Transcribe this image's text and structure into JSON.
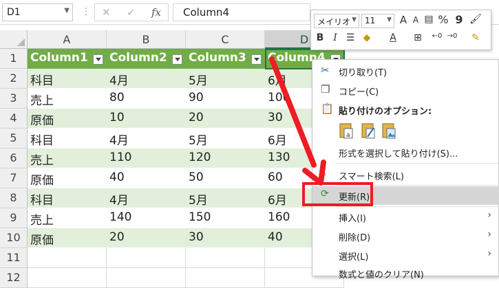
{
  "formula_bar": {
    "name_box": "D1",
    "sep": "⋮",
    "cancel": "✕",
    "enter": "✓",
    "fx": "fx",
    "value": "Column4"
  },
  "grid": {
    "columns": [
      "A",
      "B",
      "C",
      "D"
    ],
    "row_numbers": [
      "1",
      "2",
      "3",
      "4",
      "5",
      "6",
      "7",
      "8",
      "9",
      "10",
      "11",
      "12"
    ],
    "header": [
      "Column1",
      "Column2",
      "Column3",
      "Column4"
    ],
    "rows": [
      [
        "科目",
        "4月",
        "5月",
        "6月"
      ],
      [
        "売上",
        "80",
        "90",
        "100"
      ],
      [
        "原価",
        "10",
        "20",
        "30"
      ],
      [
        "科目",
        "4月",
        "5月",
        "6月"
      ],
      [
        "売上",
        "110",
        "120",
        "130"
      ],
      [
        "原価",
        "40",
        "50",
        "60"
      ],
      [
        "科目",
        "4月",
        "5月",
        "6月"
      ],
      [
        "売上",
        "140",
        "150",
        "160"
      ],
      [
        "原価",
        "20",
        "30",
        "40"
      ]
    ]
  },
  "mini_toolbar": {
    "font": "メイリオ",
    "size": "11",
    "grow": "A",
    "shrink": "A",
    "percent": "%",
    "comma": "9",
    "bold": "B",
    "italic": "I",
    "align": "☰",
    "fontcolor": "A"
  },
  "context_menu": {
    "cut": "切り取り(T)",
    "copy": "コピー(C)",
    "paste_options": "貼り付けのオプション:",
    "paste_special": "形式を選択して貼り付け(S)...",
    "smart_lookup": "スマート検索(L)",
    "refresh": "更新(R)",
    "insert": "挿入(I)",
    "delete": "削除(D)",
    "select": "選択(L)",
    "clear": "数式と値のクリア(N)",
    "submenu_arrow": "›"
  },
  "colors": {
    "table_header": "#70ad47",
    "band": "#e2efda",
    "highlight": "#ee1c24",
    "accent": "#217346"
  }
}
